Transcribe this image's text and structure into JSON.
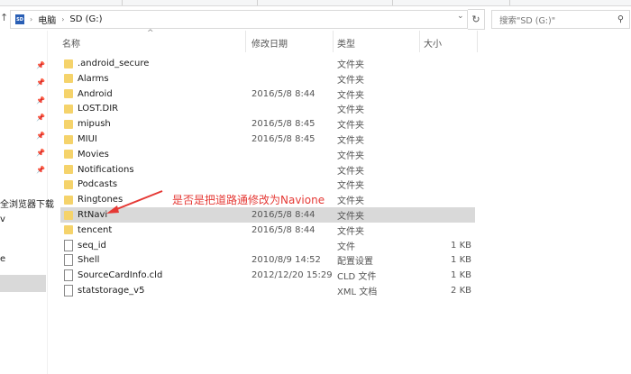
{
  "address": {
    "icon": "sd-card-icon",
    "crumbs": [
      "电脑",
      "SD (G:)"
    ]
  },
  "search": {
    "placeholder": "搜索\"SD (G:)\""
  },
  "nav": {
    "items": [
      "全浏览器下载",
      "v",
      "e"
    ]
  },
  "columns": {
    "name": "名称",
    "date": "修改日期",
    "type": "类型",
    "size": "大小"
  },
  "files": [
    {
      "name": ".android_secure",
      "date": "",
      "type": "文件夹",
      "size": "",
      "kind": "folder"
    },
    {
      "name": "Alarms",
      "date": "",
      "type": "文件夹",
      "size": "",
      "kind": "folder"
    },
    {
      "name": "Android",
      "date": "2016/5/8 8:44",
      "type": "文件夹",
      "size": "",
      "kind": "folder"
    },
    {
      "name": "LOST.DIR",
      "date": "",
      "type": "文件夹",
      "size": "",
      "kind": "folder"
    },
    {
      "name": "mipush",
      "date": "2016/5/8 8:45",
      "type": "文件夹",
      "size": "",
      "kind": "folder"
    },
    {
      "name": "MIUI",
      "date": "2016/5/8 8:45",
      "type": "文件夹",
      "size": "",
      "kind": "folder"
    },
    {
      "name": "Movies",
      "date": "",
      "type": "文件夹",
      "size": "",
      "kind": "folder"
    },
    {
      "name": "Notifications",
      "date": "",
      "type": "文件夹",
      "size": "",
      "kind": "folder"
    },
    {
      "name": "Podcasts",
      "date": "",
      "type": "文件夹",
      "size": "",
      "kind": "folder"
    },
    {
      "name": "Ringtones",
      "date": "",
      "type": "文件夹",
      "size": "",
      "kind": "folder"
    },
    {
      "name": "RtNavi",
      "date": "2016/5/8 8:44",
      "type": "文件夹",
      "size": "",
      "kind": "folder",
      "selected": true
    },
    {
      "name": "tencent",
      "date": "2016/5/8 8:44",
      "type": "文件夹",
      "size": "",
      "kind": "folder"
    },
    {
      "name": "seq_id",
      "date": "",
      "type": "文件",
      "size": "1 KB",
      "kind": "file"
    },
    {
      "name": "Shell",
      "date": "2010/8/9 14:52",
      "type": "配置设置",
      "size": "1 KB",
      "kind": "file"
    },
    {
      "name": "SourceCardInfo.cld",
      "date": "2012/12/20 15:29",
      "type": "CLD 文件",
      "size": "1 KB",
      "kind": "file"
    },
    {
      "name": "statstorage_v5",
      "date": "",
      "type": "XML 文档",
      "size": "2 KB",
      "kind": "file"
    }
  ],
  "annotation": {
    "text": "是否是把道路通修改为Navione",
    "color": "#e53935"
  }
}
